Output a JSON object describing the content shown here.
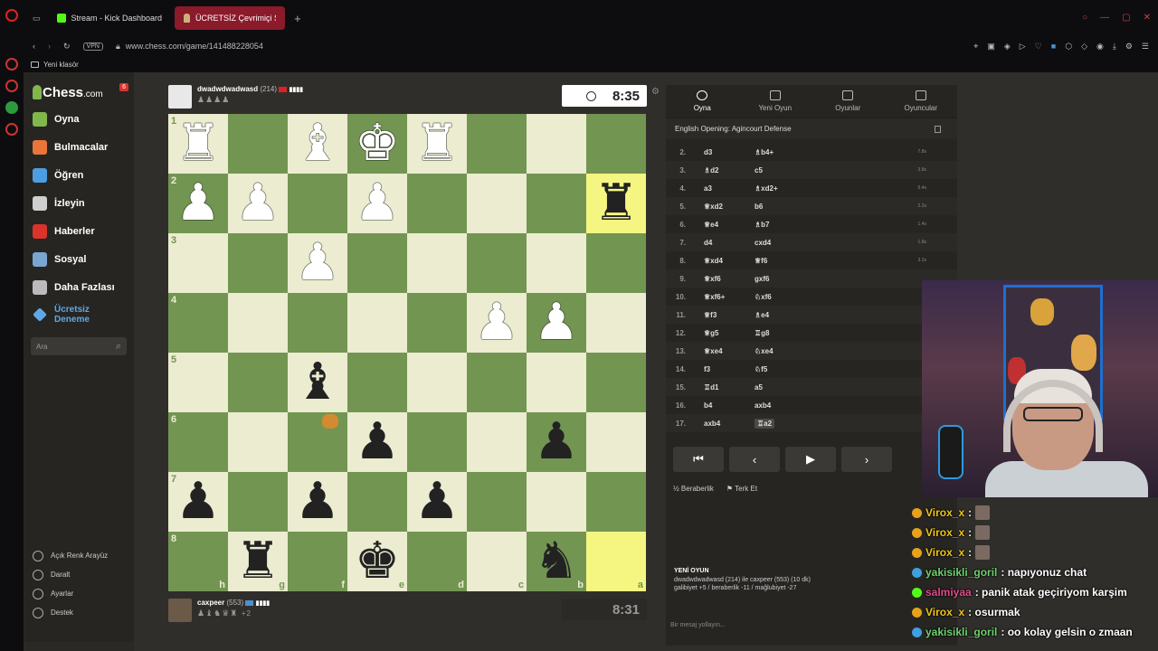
{
  "browser": {
    "tabs": [
      {
        "label": "Stream - Kick Dashboard",
        "active": false
      },
      {
        "label": "ÜCRETSİZ Çevrimiçi Satr",
        "active": true
      }
    ],
    "new_tab": "+",
    "url": "www.chess.com/game/141488228054",
    "vpn": "VPN",
    "bookmark": "Yeni klasör"
  },
  "nav": {
    "logo_text": "Chess",
    "logo_suffix": ".com",
    "notif_count": "6",
    "items": [
      {
        "label": "Oyna",
        "color": "#81b64c"
      },
      {
        "label": "Bulmacalar",
        "color": "#e8763a"
      },
      {
        "label": "Öğren",
        "color": "#4d9ee0"
      },
      {
        "label": "İzleyin",
        "color": "#cfcfcf"
      },
      {
        "label": "Haberler",
        "color": "#d9332b"
      },
      {
        "label": "Sosyal",
        "color": "#7aa5d0"
      },
      {
        "label": "Daha Fazlası",
        "color": "#bbbbbb"
      }
    ],
    "trial_label": "Ücretsiz Deneme",
    "search_placeholder": "Ara",
    "bottom": [
      {
        "label": "Açık Renk Arayüz"
      },
      {
        "label": "Daralt"
      },
      {
        "label": "Ayarlar"
      },
      {
        "label": "Destek"
      }
    ]
  },
  "game": {
    "top_player": {
      "name": "dwadwdwadwasd",
      "rating": "(214)",
      "captured": "♟♟♟♟",
      "clock": "8:35"
    },
    "bottom_player": {
      "name": "caxpeer",
      "rating": "(553)",
      "captured": "♟♝♞♛♜",
      "extra": "+2",
      "clock": "8:31"
    },
    "ranks": [
      "1",
      "2",
      "3",
      "4",
      "5",
      "6",
      "7",
      "8"
    ],
    "files": [
      "h",
      "g",
      "f",
      "e",
      "d",
      "c",
      "b",
      "a"
    ],
    "board": [
      [
        "R",
        "",
        "B",
        "K",
        "R",
        "",
        "",
        ""
      ],
      [
        "P",
        "P",
        "",
        "P",
        "",
        "",
        "",
        "r"
      ],
      [
        "",
        "",
        "P",
        "",
        "",
        "",
        "",
        ""
      ],
      [
        "",
        "",
        "",
        "",
        "",
        "P",
        "P",
        ""
      ],
      [
        "",
        "",
        "b",
        "",
        "",
        "",
        "",
        ""
      ],
      [
        "",
        "",
        "",
        "p",
        "",
        "",
        "p",
        ""
      ],
      [
        "p",
        "",
        "p",
        "",
        "p",
        "",
        "",
        ""
      ],
      [
        "",
        "r",
        "",
        "k",
        "",
        "",
        "n",
        ""
      ]
    ],
    "highlights": [
      [
        1,
        7
      ],
      [
        7,
        7
      ]
    ]
  },
  "panel": {
    "tabs": [
      "Oyna",
      "Yeni Oyun",
      "Oyunlar",
      "Oyuncular"
    ],
    "opening": "English Opening: Agincourt Defense",
    "moves": [
      {
        "n": "2.",
        "w": "d3",
        "b": "♗b4+",
        "t": "7.8s"
      },
      {
        "n": "3.",
        "w": "♗d2",
        "b": "c5",
        "t": "3.8s"
      },
      {
        "n": "4.",
        "w": "a3",
        "b": "♗xd2+",
        "t": "6.4s"
      },
      {
        "n": "5.",
        "w": "♕xd2",
        "b": "b6",
        "t": "2.2s"
      },
      {
        "n": "6.",
        "w": "♕e4",
        "b": "♗b7",
        "t": "1.4s"
      },
      {
        "n": "7.",
        "w": "d4",
        "b": "cxd4",
        "t": "1.8s"
      },
      {
        "n": "8.",
        "w": "♕xd4",
        "b": "♕f6",
        "t": "3.2s"
      },
      {
        "n": "9.",
        "w": "♕xf6",
        "b": "gxf6",
        "t": ""
      },
      {
        "n": "10.",
        "w": "♕xf6+",
        "b": "♘xf6",
        "t": ""
      },
      {
        "n": "11.",
        "w": "♕f3",
        "b": "♗e4",
        "t": ""
      },
      {
        "n": "12.",
        "w": "♕g5",
        "b": "♖g8",
        "t": ""
      },
      {
        "n": "13.",
        "w": "♕xe4",
        "b": "♘xe4",
        "t": ""
      },
      {
        "n": "14.",
        "w": "f3",
        "b": "♘f5",
        "t": ""
      },
      {
        "n": "15.",
        "w": "♖d1",
        "b": "a5",
        "t": ""
      },
      {
        "n": "16.",
        "w": "b4",
        "b": "axb4",
        "t": ""
      },
      {
        "n": "17.",
        "w": "axb4",
        "b": "♖a2",
        "t": ""
      }
    ],
    "controls": [
      "⏮",
      "‹",
      "▶",
      "›"
    ],
    "draw": "Beraberlik",
    "resign": "Terk Et",
    "new_game_title": "YENİ OYUN",
    "new_game_line1": "dwadwdwadwasd (214) ile caxpeer (553) (10 dk)",
    "new_game_line2": "galibiyet +5 / beraberlik -11 / mağlubiyet -27",
    "chat_placeholder": "Bir mesaj yollayın..."
  },
  "chat": [
    {
      "user": "Virox_x",
      "msg": ":",
      "color": "#f0c419",
      "badge": "#e8a21a",
      "emote": true
    },
    {
      "user": "Virox_x",
      "msg": ":",
      "color": "#f0c419",
      "badge": "#e8a21a",
      "emote": true
    },
    {
      "user": "Virox_x",
      "msg": ":",
      "color": "#f0c419",
      "badge": "#e8a21a",
      "emote": true
    },
    {
      "user": "yakisikli_goril",
      "msg": ": napıyonuz chat",
      "color": "#6fd16f",
      "badge": "#3fa0e0",
      "emote": false
    },
    {
      "user": "salmiyaa",
      "msg": ": panik atak geçiriyom karşim",
      "color": "#e04a8a",
      "badge": "#53fc18",
      "emote": false
    },
    {
      "user": "Virox_x",
      "msg": ": osurmak",
      "color": "#f0c419",
      "badge": "#e8a21a",
      "emote": false
    },
    {
      "user": "yakisikli_goril",
      "msg": ": oo kolay gelsin o zmaan",
      "color": "#6fd16f",
      "badge": "#3fa0e0",
      "emote": false
    }
  ]
}
